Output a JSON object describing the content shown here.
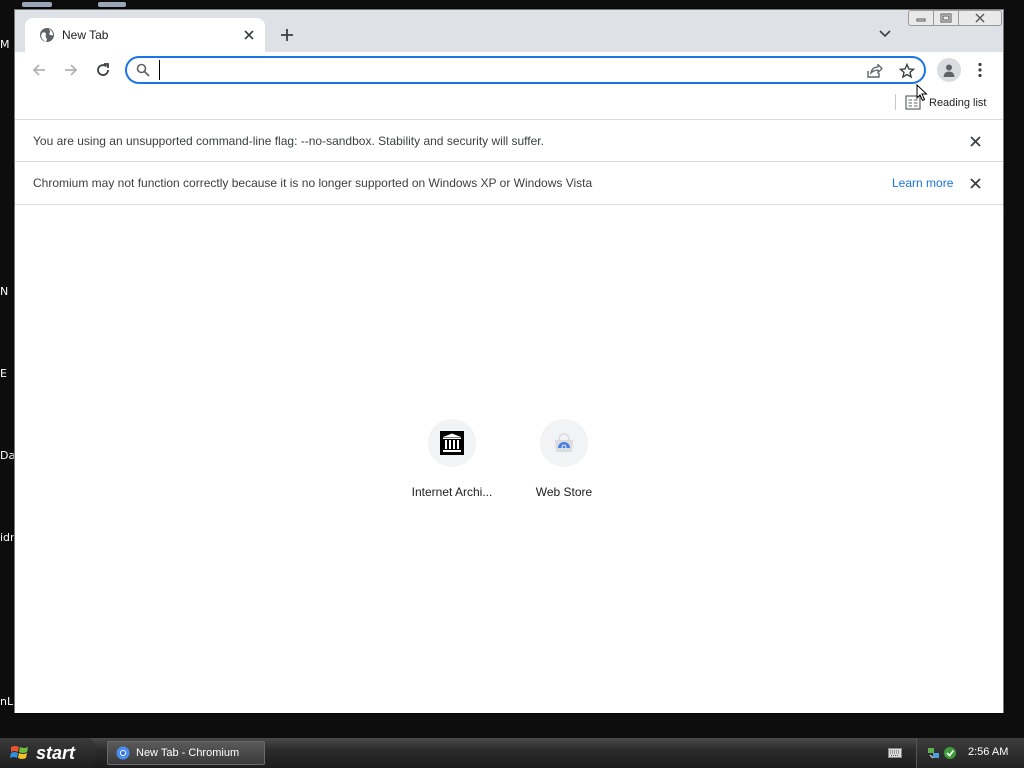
{
  "desktop": {
    "edge_labels": [
      "M",
      "N",
      "E",
      "Da",
      "idr",
      "nL"
    ]
  },
  "browser": {
    "tab": {
      "title": "New Tab"
    },
    "omnibox": {
      "value": "",
      "placeholder": ""
    },
    "bookmarks": {
      "reading_list_label": "Reading list"
    },
    "infobars": [
      {
        "message": "You are using an unsupported command-line flag: --no-sandbox. Stability and security will suffer."
      },
      {
        "message": "Chromium may not function correctly because it is no longer supported on Windows XP or Windows Vista",
        "link": "Learn more"
      }
    ],
    "shortcuts": [
      {
        "label": "Internet Archi...",
        "icon": "archive-icon"
      },
      {
        "label": "Web Store",
        "icon": "web-store-icon"
      }
    ]
  },
  "taskbar": {
    "start_label": "start",
    "task_label": "New Tab - Chromium",
    "clock": "2:56 AM"
  },
  "colors": {
    "accent": "#1a73e8",
    "titlebar": "#dee1e6",
    "taskbar": "#2b2b2b"
  }
}
